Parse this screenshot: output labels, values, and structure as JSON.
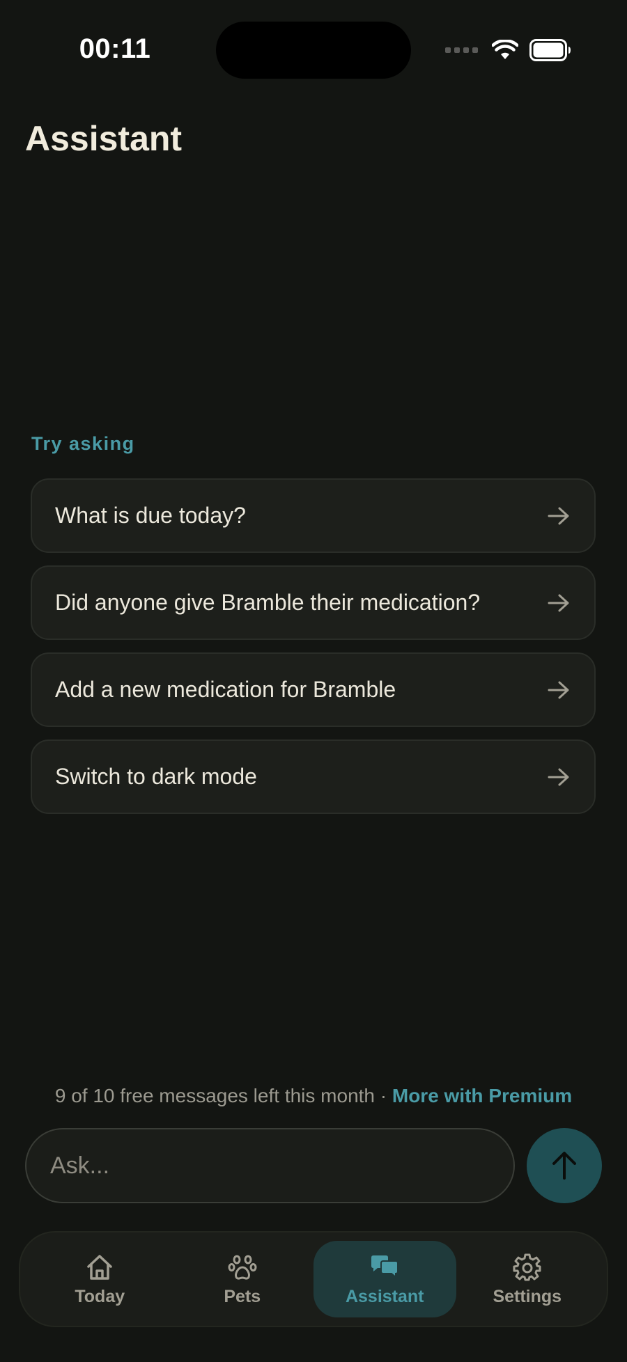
{
  "status_bar": {
    "time": "00:11"
  },
  "header": {
    "title": "Assistant"
  },
  "suggestions": {
    "label": "Try asking",
    "items": [
      {
        "text": "What is due today?",
        "icon": "arrow-right-icon"
      },
      {
        "text": "Did anyone give Bramble their medication?",
        "icon": "arrow-right-icon"
      },
      {
        "text": "Add a new medication for Bramble",
        "icon": "arrow-right-icon"
      },
      {
        "text": "Switch to dark mode",
        "icon": "arrow-right-icon"
      }
    ]
  },
  "quota": {
    "text": "9 of 10 free messages left this month · ",
    "premium_link": "More with Premium"
  },
  "composer": {
    "placeholder": "Ask...",
    "send_icon": "arrow-up-icon"
  },
  "tab_bar": {
    "tabs": [
      {
        "label": "Today",
        "icon": "house-icon",
        "active": false
      },
      {
        "label": "Pets",
        "icon": "paw-icon",
        "active": false
      },
      {
        "label": "Assistant",
        "icon": "chat-bubbles-icon",
        "active": true
      },
      {
        "label": "Settings",
        "icon": "gear-icon",
        "active": false
      }
    ]
  },
  "colors": {
    "background": "#131512",
    "accent": "#4a9ba6",
    "card": "#1d1f1b",
    "active_tab": "#1f3a3b",
    "send_button": "#1f4f54"
  }
}
